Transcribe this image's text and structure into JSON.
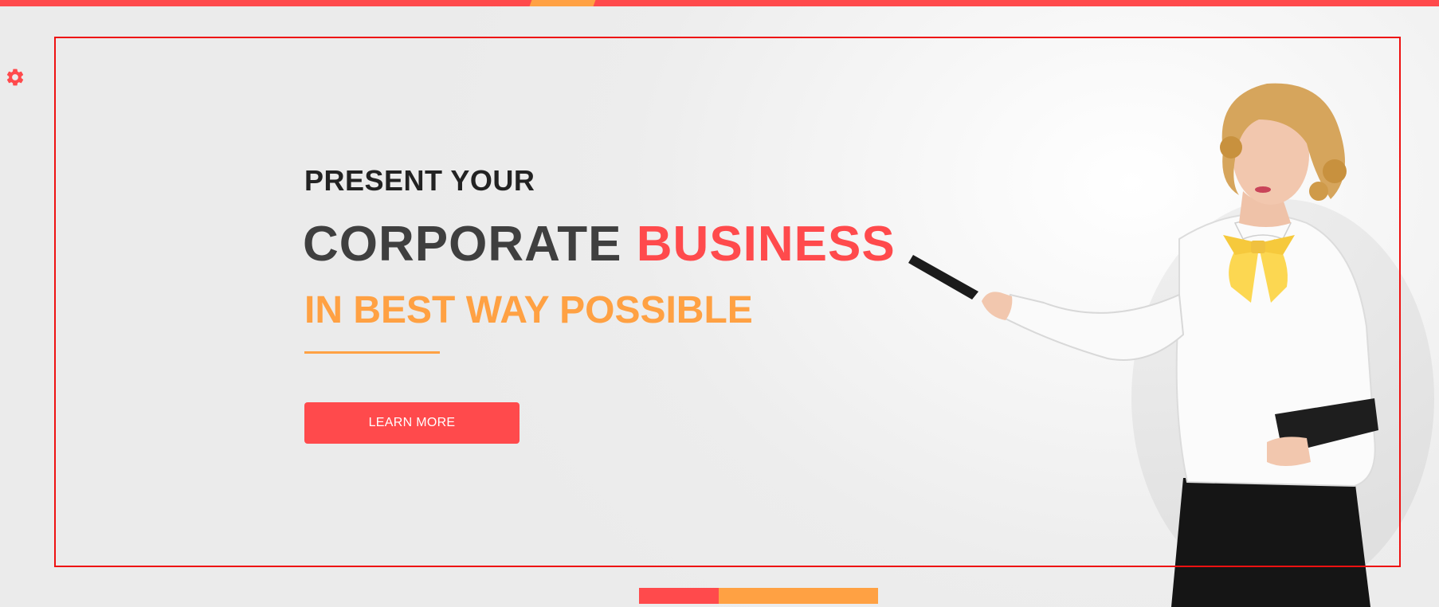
{
  "hero": {
    "line1": "PRESENT YOUR",
    "line2_part1": "CORPORATE",
    "line2_part2": "BUSINESS",
    "line3": "IN BEST WAY POSSIBLE",
    "cta_label": "LEARN MORE"
  },
  "icons": {
    "settings": "gear-icon"
  },
  "colors": {
    "primary": "#ff4a4c",
    "secondary": "#ffa143",
    "text_dark": "#222222",
    "text_mid": "#3f3f3f",
    "background": "#ececec"
  }
}
